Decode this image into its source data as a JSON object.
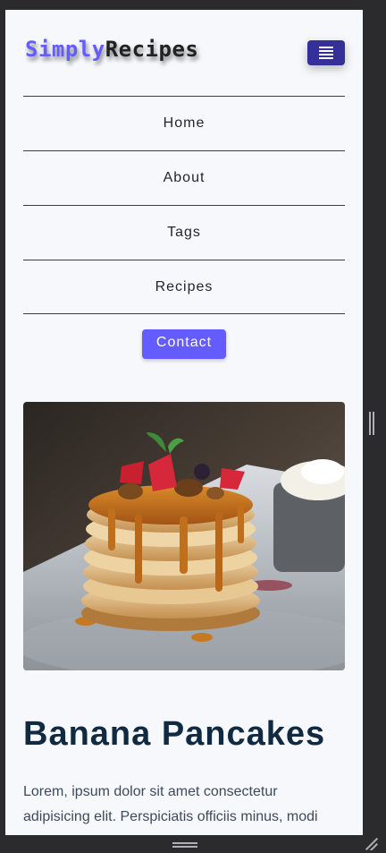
{
  "brand": {
    "logo_part1": "Simply",
    "logo_part2": "Recipes",
    "accent_color": "#645cff",
    "toggle_color": "#352f99"
  },
  "nav": {
    "toggle_icon": "hamburger-icon",
    "links": [
      {
        "label": "Home"
      },
      {
        "label": "About"
      },
      {
        "label": "Tags"
      },
      {
        "label": "Recipes"
      }
    ],
    "contact_label": "Contact"
  },
  "hero": {
    "image": "pancake-stack-photo"
  },
  "recipe": {
    "title": "Banana Pancakes",
    "description": "Lorem, ipsum dolor sit amet consectetur adipisicing elit. Perspiciatis officiis minus, modi"
  }
}
